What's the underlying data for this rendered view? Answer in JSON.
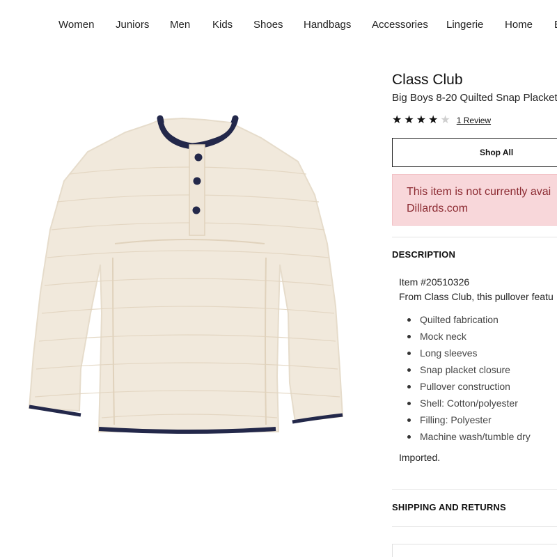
{
  "nav": {
    "items": [
      "Women",
      "Juniors",
      "Men",
      "Kids",
      "Shoes",
      "Handbags",
      "Accessories",
      "Lingerie",
      "Home",
      "B"
    ]
  },
  "product": {
    "brand": "Class Club",
    "title": "Big Boys 8-20 Quilted Snap Placket",
    "rating": 4,
    "rating_max": 5,
    "review_link": "1 Review",
    "shop_all_label": "Shop All",
    "alert_line1": "This item is not currently avai",
    "alert_line2": "Dillards.com",
    "image": {
      "alt": "Oatmeal quilted snap placket pullover with navy trim",
      "colors": {
        "body": "#f1e9dc",
        "trim": "#23284a",
        "shadow": "#e4d8c6"
      }
    }
  },
  "description": {
    "heading": "DESCRIPTION",
    "item_number": "Item #20510326",
    "intro": "From Class Club, this pullover featu",
    "features": [
      "Quilted fabrication",
      "Mock neck",
      "Long sleeves",
      "Snap placket closure",
      "Pullover construction",
      "Shell: Cotton/polyester",
      "Filling: Polyester",
      "Machine wash/tumble dry"
    ],
    "imported": "Imported."
  },
  "shipping": {
    "heading": "SHIPPING AND RETURNS"
  },
  "colors": {
    "alert_bg": "#f8d7da",
    "alert_text": "#8c2b32",
    "trim": "#23284a"
  }
}
